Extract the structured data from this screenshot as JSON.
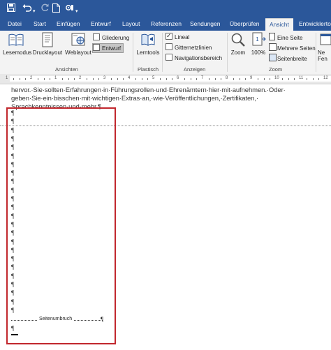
{
  "quick_access": {
    "icons": [
      "save-icon",
      "undo-icon",
      "redo-icon",
      "new-document-icon",
      "customize-icon"
    ]
  },
  "tabs": [
    {
      "label": "Datei"
    },
    {
      "label": "Start"
    },
    {
      "label": "Einfügen"
    },
    {
      "label": "Entwurf"
    },
    {
      "label": "Layout"
    },
    {
      "label": "Referenzen"
    },
    {
      "label": "Sendungen"
    },
    {
      "label": "Überprüfen"
    },
    {
      "label": "Ansicht"
    },
    {
      "label": "Entwicklertools"
    }
  ],
  "ribbon": {
    "ansichten": {
      "group_label": "Ansichten",
      "lesemodus": "Lesemodus",
      "drucklayout": "Drucklayout",
      "weblayout": "Weblayout",
      "gliederung": "Gliederung",
      "entwurf": "Entwurf"
    },
    "plastisch": {
      "group_label": "Plastisch",
      "lerntools": "Lerntools"
    },
    "anzeigen": {
      "group_label": "Anzeigen",
      "lineal": "Lineal",
      "lineal_checked": true,
      "gitternetzlinien": "Gitternetzlinien",
      "gitternetzlinien_checked": false,
      "navigationsbereich": "Navigationsbereich",
      "navigationsbereich_checked": false
    },
    "zoom": {
      "group_label": "Zoom",
      "zoom": "Zoom",
      "percent": "100%",
      "eine_seite": "Eine Seite",
      "mehrere_seiten": "Mehrere Seiten",
      "seitenbreite": "Seitenbreite"
    },
    "fenster": {
      "neues_label": "Ne",
      "fenster_label": "Fen"
    }
  },
  "ruler": {
    "numbers": [
      "1",
      "2",
      "1",
      "2",
      "3",
      "4",
      "5",
      "6",
      "7",
      "8",
      "9",
      "10",
      "11",
      "12"
    ]
  },
  "document": {
    "lines": [
      "hervor.·Sie·sollten·Erfahrungen·in·Führungsrollen·und·Ehrenämtern·hier·mit·aufnehmen.·Oder·",
      "geben·Sie·ein·bisschen·mit·wichtigen·Extras·an,·wie·Veröffentlichungen,·Zertifikaten,·",
      "Sprachkenntnissen·und·mehr.¶"
    ],
    "paragraph_mark": "¶",
    "page_break_label": "Seitenumbruch"
  },
  "colors": {
    "title_bar": "#2b579a",
    "ribbon": "#f3f3f3",
    "highlight_border": "#c1272d"
  }
}
